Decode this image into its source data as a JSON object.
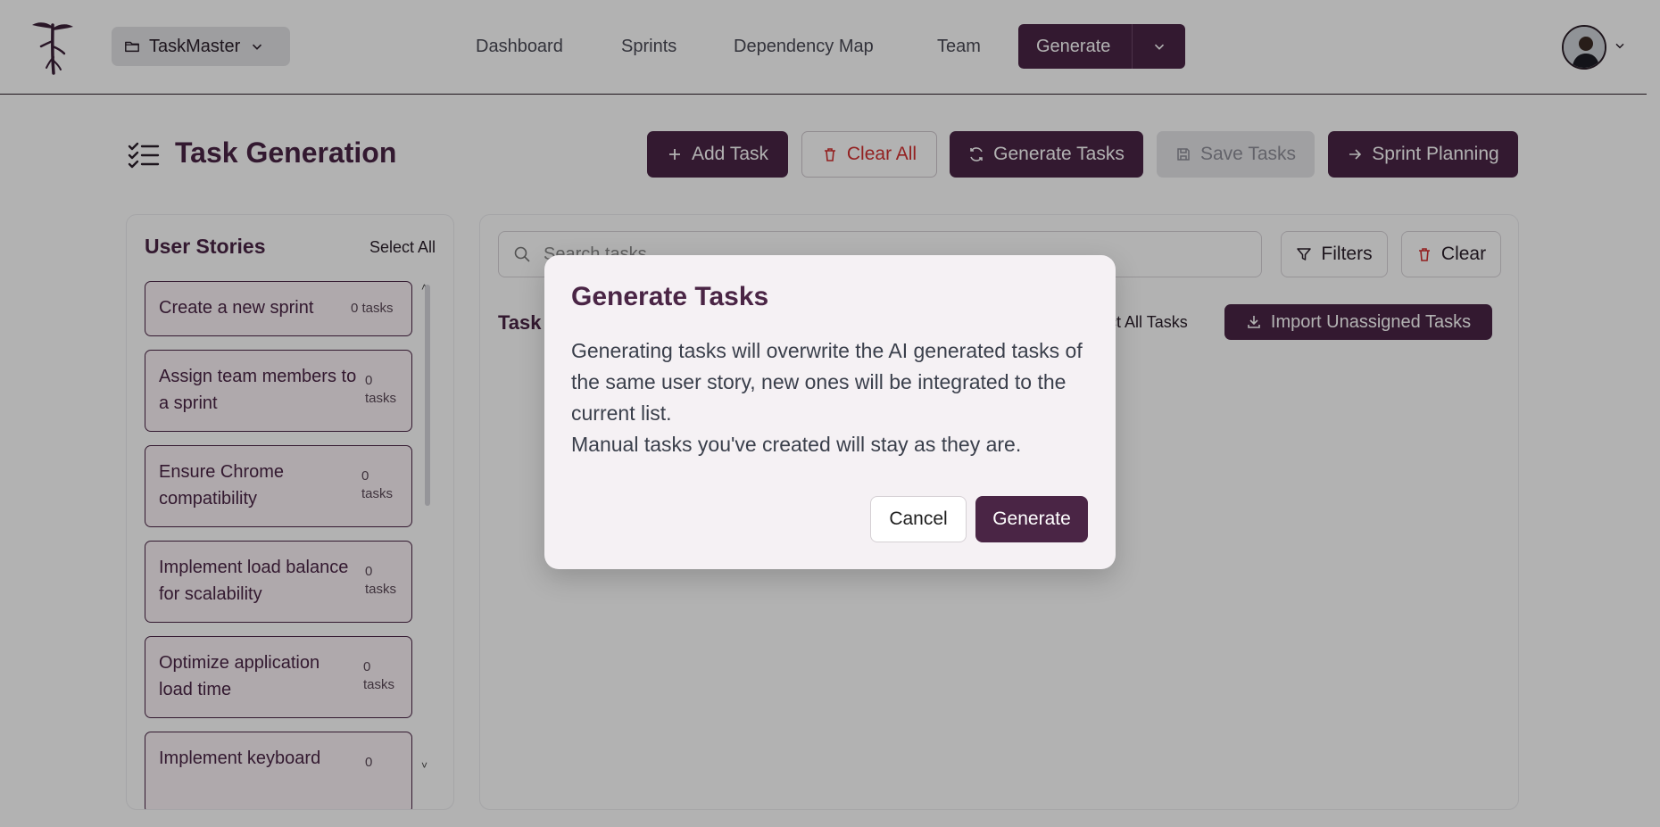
{
  "header": {
    "project_label": "TaskMaster",
    "nav": [
      "Dashboard",
      "Sprints",
      "Dependency Map",
      "Team"
    ],
    "generate_label": "Generate"
  },
  "page": {
    "title": "Task Generation",
    "toolbar": {
      "add_task": "Add Task",
      "clear_all": "Clear All",
      "generate_tasks": "Generate Tasks",
      "save_tasks": "Save Tasks",
      "sprint_planning": "Sprint Planning"
    }
  },
  "stories_panel": {
    "title": "User Stories",
    "select_all": "Select All",
    "stories": [
      {
        "title": "Create a new sprint",
        "count": "0 tasks"
      },
      {
        "title": "Assign team members to a sprint",
        "count": "0 tasks"
      },
      {
        "title": "Ensure Chrome compatibility",
        "count": "0 tasks"
      },
      {
        "title": "Implement load balance for scalability",
        "count": "0 tasks"
      },
      {
        "title": "Optimize application load time",
        "count": "0 tasks"
      },
      {
        "title": "Implement keyboard",
        "count": "0"
      }
    ]
  },
  "tasks_panel": {
    "search_placeholder": "Search tasks",
    "filters_label": "Filters",
    "clear_label": "Clear",
    "tasks_label": "Task",
    "select_all_tasks": "lect All Tasks",
    "import_label": "Import Unassigned Tasks"
  },
  "modal": {
    "title": "Generate Tasks",
    "body_line1": "Generating tasks will overwrite the AI generated tasks of the same user story, new ones will be integrated to the current list.",
    "body_line2": "Manual tasks you've created will stay as they are.",
    "cancel_label": "Cancel",
    "generate_label": "Generate"
  },
  "colors": {
    "brand": "#4a2545",
    "danger": "#d32f2f"
  }
}
